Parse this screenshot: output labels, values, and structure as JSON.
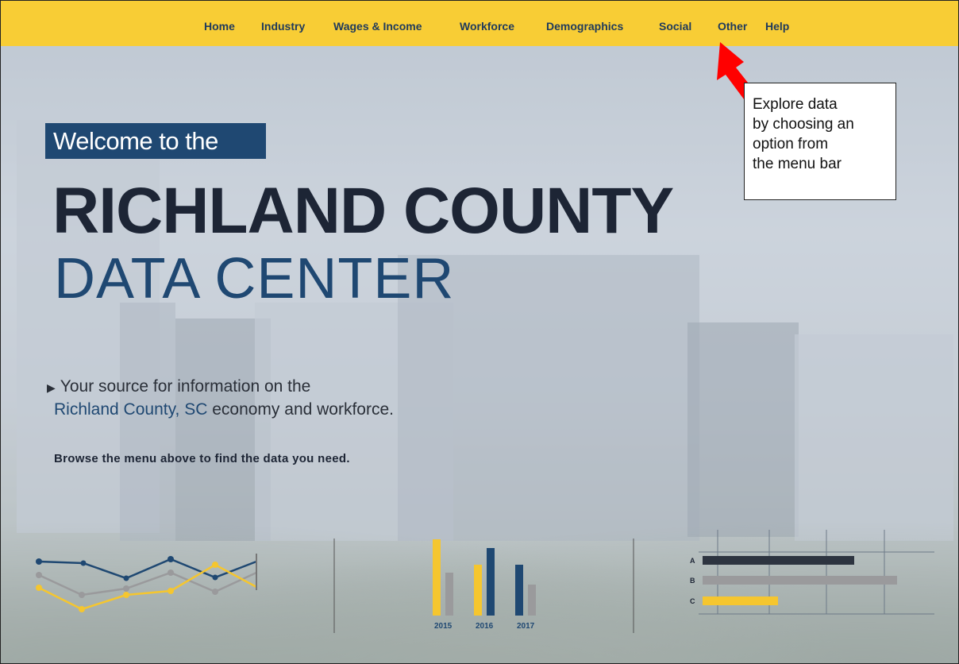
{
  "nav": {
    "items": [
      "Home",
      "Industry",
      "Wages & Income",
      "Workforce",
      "Demographics",
      "Social",
      "Other",
      "Help"
    ]
  },
  "hero": {
    "welcome": "Welcome to the",
    "title_line1": "RICHLAND COUNTY",
    "title_line2": "DATA CENTER",
    "source_prefix": "Your source for information on the",
    "source_highlight": "Richland County, SC",
    "source_suffix": "economy and workforce.",
    "browse": "Browse the menu above to find the data you need."
  },
  "callout": {
    "lines": [
      "Explore data",
      "by choosing an",
      "option from",
      "the menu bar"
    ]
  },
  "decor": {
    "bar_years": [
      "2015",
      "2016",
      "2017"
    ],
    "hbar_labels": [
      "A",
      "B",
      "C"
    ]
  },
  "colors": {
    "nav_bg": "#f8cd35",
    "navy": "#1f4872",
    "dark": "#1d2535",
    "yellow": "#f5c62f",
    "gray": "#9a9a9c",
    "arrow": "#ff0000"
  }
}
